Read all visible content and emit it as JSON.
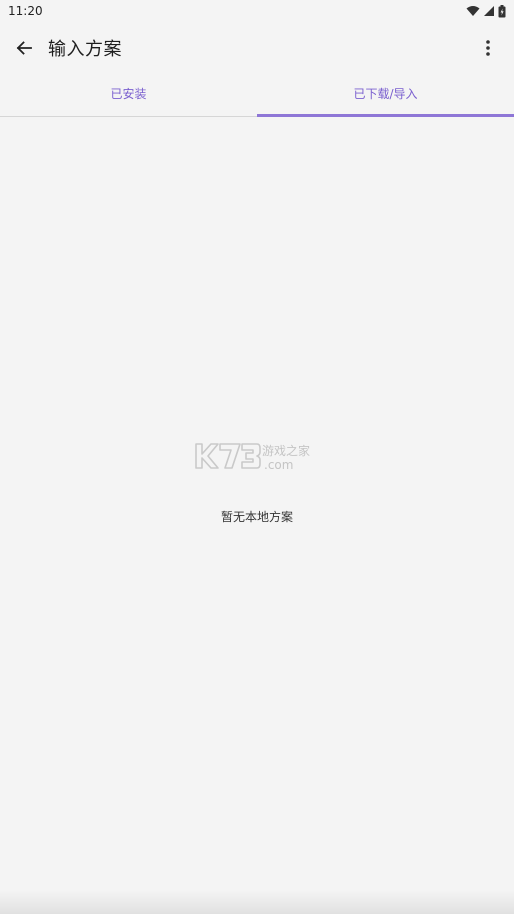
{
  "status_bar": {
    "time": "11:20",
    "icons": [
      "wifi-icon",
      "signal-icon",
      "battery-icon"
    ]
  },
  "app_bar": {
    "title": "输入方案",
    "back_icon": "arrow-left-icon",
    "menu_icon": "more-vert-icon"
  },
  "tabs": [
    {
      "label": "已安装",
      "active": false
    },
    {
      "label": "已下载/导入",
      "active": true
    }
  ],
  "empty_state": {
    "message": "暂无本地方案"
  },
  "watermark": {
    "brand": "K73",
    "tagline": "游戏之家",
    "domain": ".com"
  },
  "colors": {
    "accent": "#8e76d6",
    "tab_text": "#7a5fcf",
    "background": "#f4f4f4"
  }
}
